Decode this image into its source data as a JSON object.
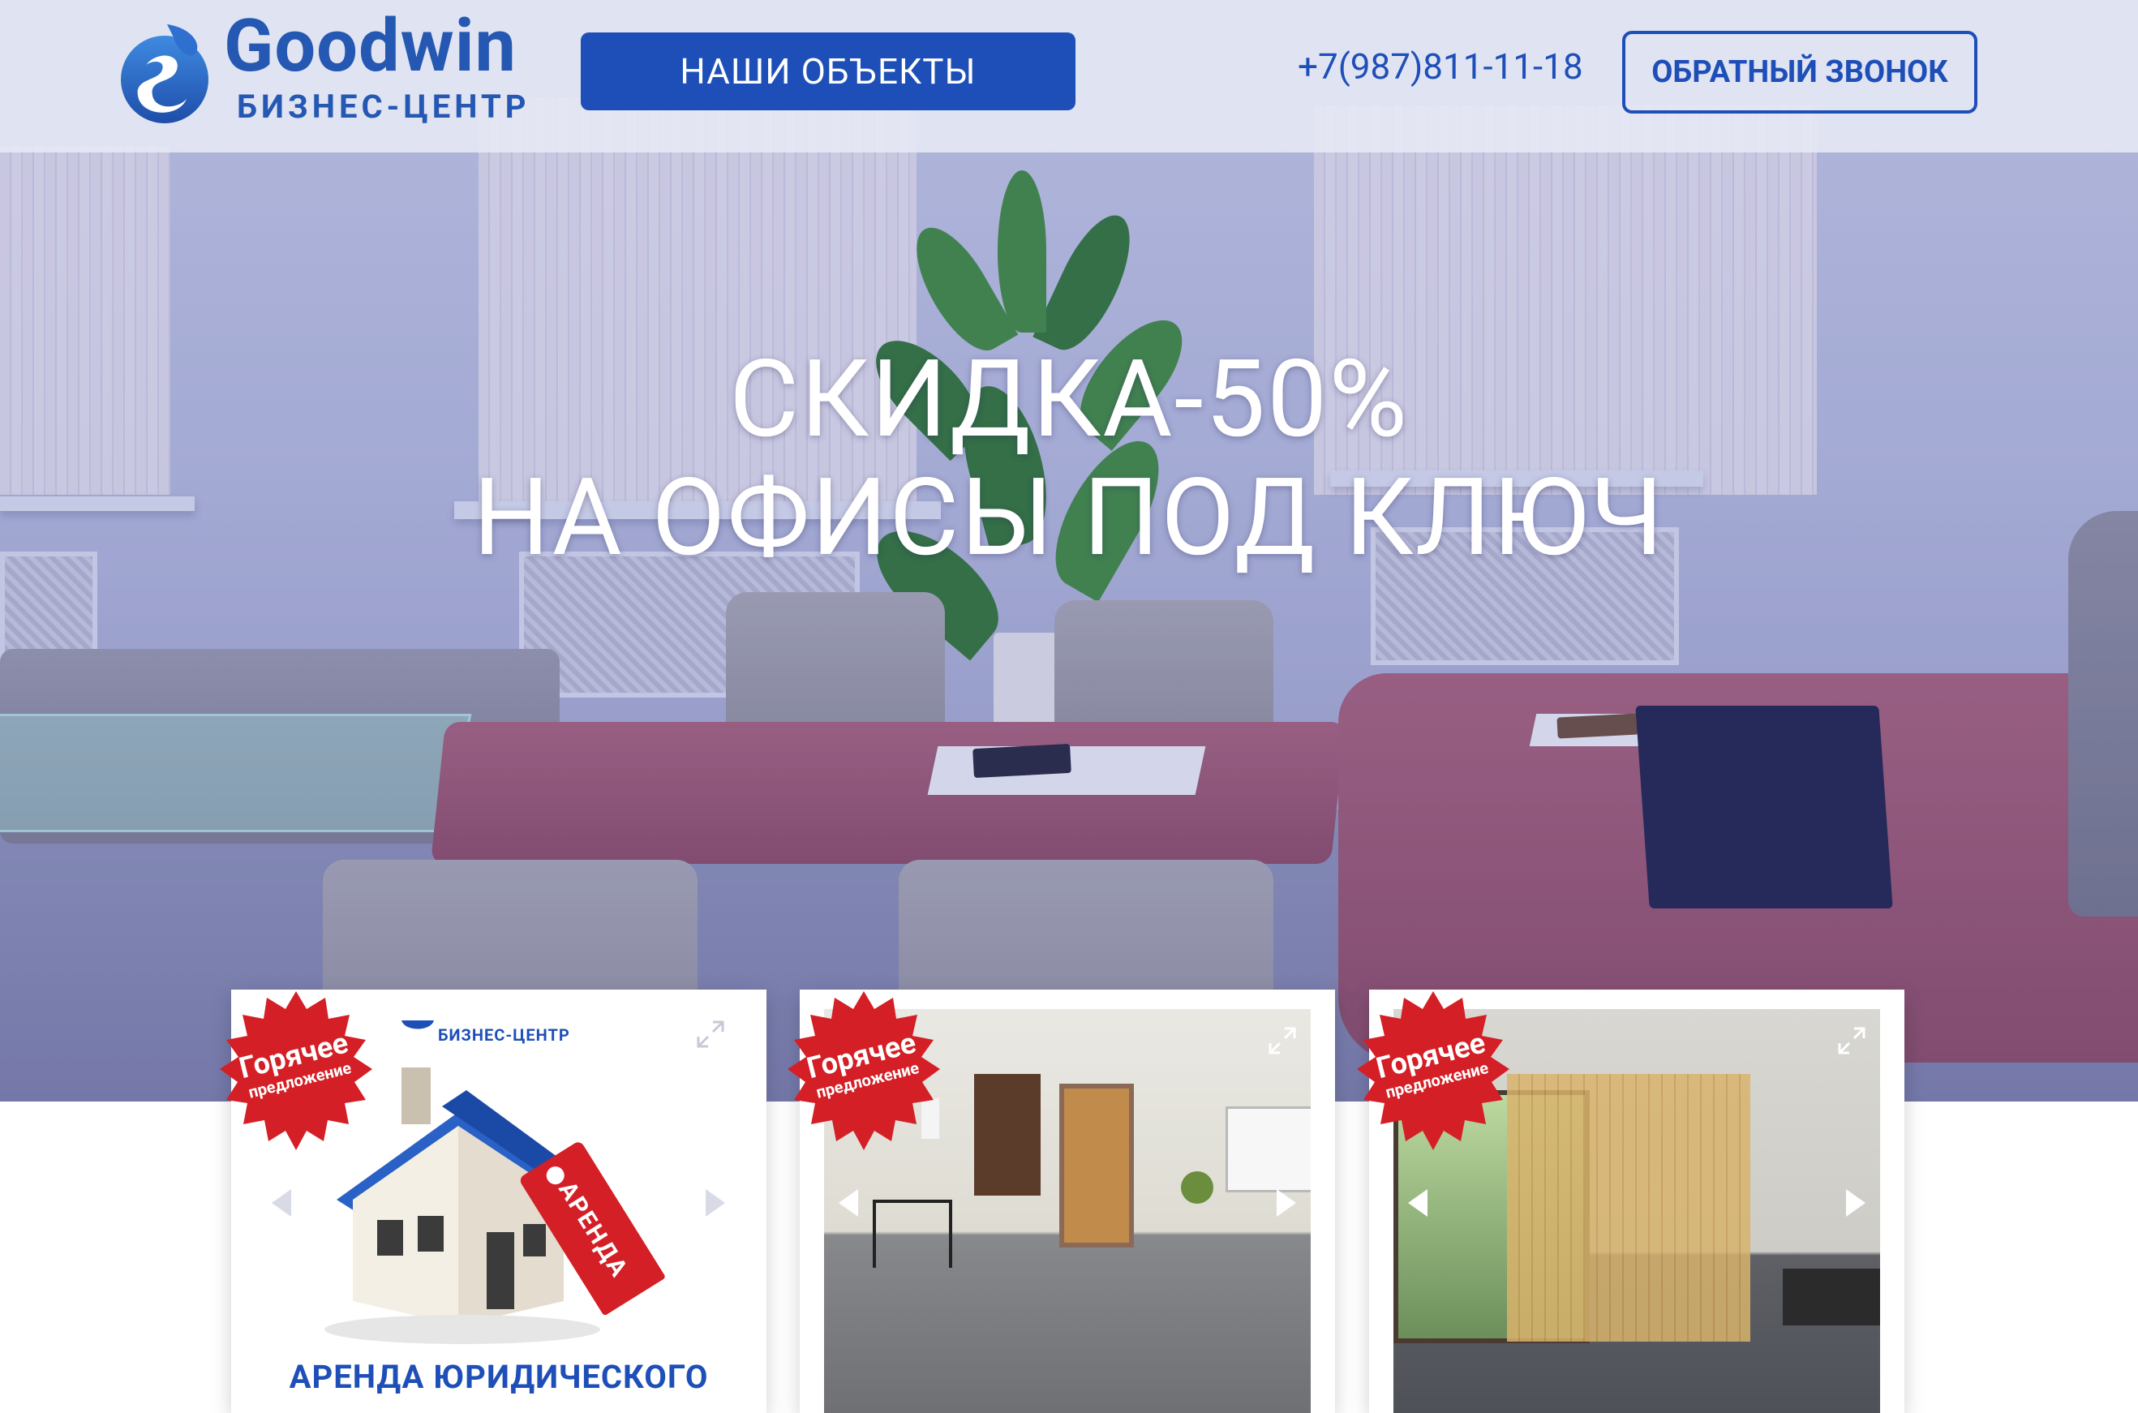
{
  "header": {
    "logo_title": "Goodwin",
    "logo_subtitle": "БИЗНЕС-ЦЕНТР",
    "nav_button": "НАШИ ОБЪЕКТЫ",
    "phone": "+7(987)811-11-18",
    "callback_button": "ОБРАТНЫЙ ЗВОНОК"
  },
  "hero": {
    "title_line1": "СКИДКА-50%",
    "title_line2": "НА ОФИСЫ ПОД КЛЮЧ"
  },
  "cards": [
    {
      "badge_line1": "Горячее",
      "badge_line2": "предложение",
      "brand": "БИЗНЕС-ЦЕНТР",
      "tag": "АРЕНДА",
      "caption": "АРЕНДА ЮРИДИЧЕСКОГО"
    },
    {
      "badge_line1": "Горячее",
      "badge_line2": "предложение"
    },
    {
      "badge_line1": "Горячее",
      "badge_line2": "предложение"
    }
  ],
  "colors": {
    "brand_blue": "#1e4fb8",
    "badge_red": "#d31f25",
    "header_bg": "#e8eaf6",
    "hero_text": "#ffffff"
  },
  "icons": {
    "expand": "expand-icon",
    "prev": "arrow-left-icon",
    "next": "arrow-right-icon"
  }
}
